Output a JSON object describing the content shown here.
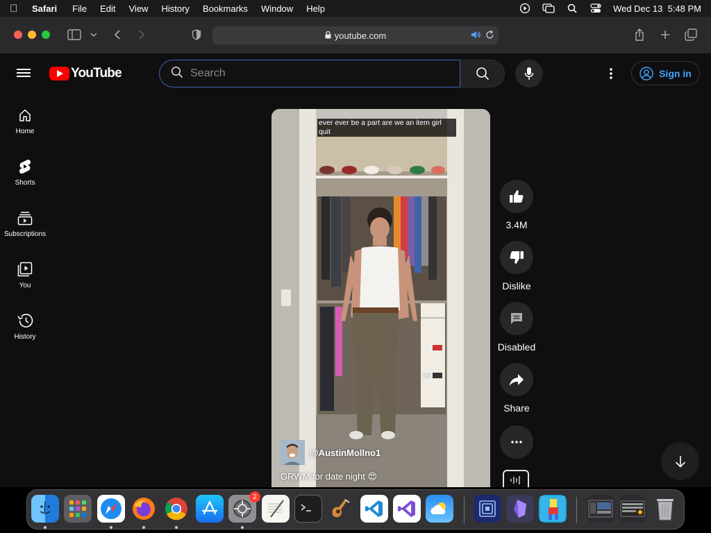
{
  "menubar": {
    "app_name": "Safari",
    "items": [
      "File",
      "Edit",
      "View",
      "History",
      "Bookmarks",
      "Window",
      "Help"
    ],
    "clock": "Wed Dec 13  5:48 PM"
  },
  "browser": {
    "url": "youtube.com"
  },
  "youtube": {
    "logo_text": "YouTube",
    "search_placeholder": "Search",
    "sign_in": "Sign in",
    "sidebar": [
      {
        "label": "Home",
        "icon": "home-icon"
      },
      {
        "label": "Shorts",
        "icon": "shorts-icon"
      },
      {
        "label": "Subscriptions",
        "icon": "subscriptions-icon"
      },
      {
        "label": "You",
        "icon": "you-icon"
      },
      {
        "label": "History",
        "icon": "history-icon"
      }
    ],
    "short": {
      "caption_overlay": "ever ever be a part are we an item girl quit",
      "channel": "@AustinMollno1",
      "title": "GRWM for date night 😍"
    },
    "actions": {
      "like_count": "3.4M",
      "dislike": "Dislike",
      "comments": "Disabled",
      "share": "Share"
    }
  },
  "dock": {
    "apps": [
      "Finder",
      "Launchpad",
      "Safari",
      "Firefox",
      "Chrome",
      "App Store",
      "System Settings",
      "TextEdit",
      "Terminal",
      "GarageBand",
      "Visual Studio Code",
      "Visual Studio",
      "Weather",
      "Remote Desktop",
      "Obsidian",
      "Game",
      "Screenshots",
      "Screenshots",
      "Trash"
    ],
    "system_settings_badge": "2"
  }
}
